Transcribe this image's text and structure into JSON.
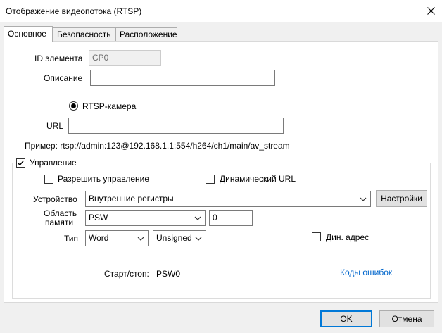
{
  "window": {
    "title": "Отображение видеопотока (RTSP)",
    "close_icon": "close-icon"
  },
  "tabs": [
    {
      "label": "Основное",
      "active": true
    },
    {
      "label": "Безопасность",
      "active": false
    },
    {
      "label": "Расположение",
      "active": false
    }
  ],
  "general": {
    "element_id_label": "ID элемента",
    "element_id_value": "CP0",
    "description_label": "Описание",
    "description_value": "",
    "rtsp_camera_label": "RTSP-камера",
    "rtsp_camera_selected": true,
    "url_label": "URL",
    "url_value": "",
    "example_text": "Пример: rtsp://admin:123@192.168.1.1:554/h264/ch1/main/av_stream"
  },
  "control": {
    "group_label": "Управление",
    "group_checked": true,
    "allow_control_label": "Разрешить управление",
    "allow_control_checked": false,
    "dynamic_url_label": "Динамический URL",
    "dynamic_url_checked": false,
    "device_label": "Устройство",
    "device_value": "Внутренние регистры",
    "settings_button": "Настройки",
    "memory_area_label_1": "Область",
    "memory_area_label_2": "памяти",
    "memory_area_value": "PSW",
    "memory_offset_value": "0",
    "type_label": "Тип",
    "type_value": "Word",
    "sign_value": "Unsigned",
    "dyn_address_label": "Дин. адрес",
    "dyn_address_checked": false,
    "start_stop_label": "Старт/стоп:",
    "start_stop_value": "PSW0",
    "error_codes_link": "Коды ошибок"
  },
  "footer": {
    "ok_button": "OK",
    "cancel_button": "Отмена"
  },
  "colors": {
    "link": "#0066cc",
    "primary_border": "#0078d7"
  }
}
